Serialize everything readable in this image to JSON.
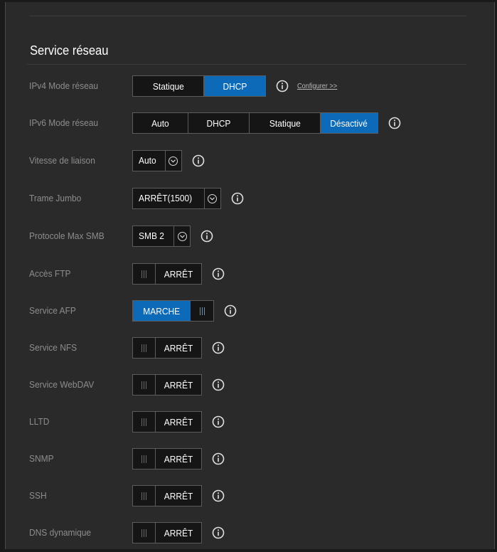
{
  "section": {
    "title": "Service réseau"
  },
  "colors": {
    "accent": "#0d6ab8",
    "background": "#2a2a2a",
    "label": "#8d8d8d"
  },
  "ipv4": {
    "label": "IPv4 Mode réseau",
    "options": [
      "Statique",
      "DHCP"
    ],
    "selected": "DHCP",
    "info_icon": "info-icon",
    "configure_link": "Configurer >>"
  },
  "ipv6": {
    "label": "IPv6 Mode réseau",
    "options": [
      "Auto",
      "DHCP",
      "Statique",
      "Désactivé"
    ],
    "selected": "Désactivé",
    "info_icon": "info-icon"
  },
  "link_speed": {
    "label": "Vitesse de liaison",
    "value": "Auto",
    "icon": "chevron-down-icon"
  },
  "jumbo_frame": {
    "label": "Trame Jumbo",
    "value": "ARRÊT(1500)",
    "icon": "chevron-down-icon"
  },
  "smb_protocol": {
    "label": "Protocole Max SMB",
    "value": "SMB 2",
    "icon": "chevron-down-icon"
  },
  "toggles": [
    {
      "id": "ftp",
      "label": "Accès FTP",
      "state": "ARRÊT",
      "on": false
    },
    {
      "id": "afp",
      "label": "Service AFP",
      "state": "MARCHE",
      "on": true
    },
    {
      "id": "nfs",
      "label": "Service NFS",
      "state": "ARRÊT",
      "on": false
    },
    {
      "id": "webdav",
      "label": "Service WebDAV",
      "state": "ARRÊT",
      "on": false
    },
    {
      "id": "lltd",
      "label": "LLTD",
      "state": "ARRÊT",
      "on": false
    },
    {
      "id": "snmp",
      "label": "SNMP",
      "state": "ARRÊT",
      "on": false
    },
    {
      "id": "ssh",
      "label": "SSH",
      "state": "ARRÊT",
      "on": false
    },
    {
      "id": "ddns",
      "label": "DNS dynamique",
      "state": "ARRÊT",
      "on": false
    }
  ]
}
